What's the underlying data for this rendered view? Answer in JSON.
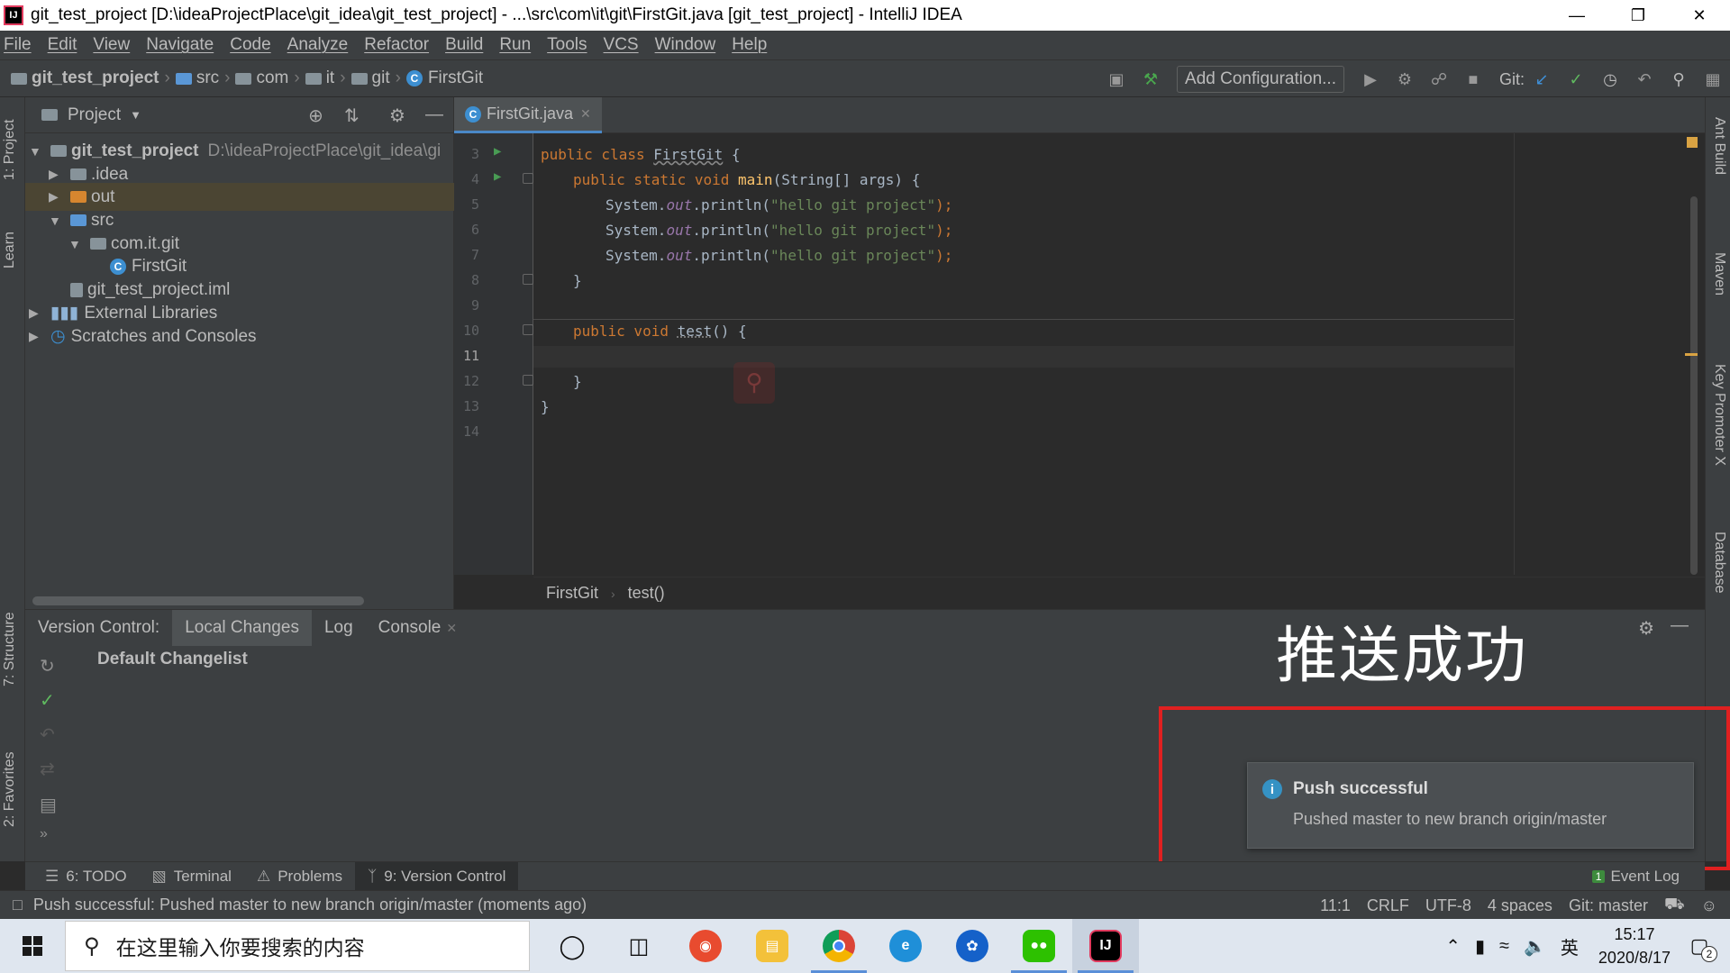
{
  "window": {
    "title": "git_test_project [D:\\ideaProjectPlace\\git_idea\\git_test_project] - ...\\src\\com\\it\\git\\FirstGit.java [git_test_project] - IntelliJ IDEA",
    "app_icon_label": "IJ"
  },
  "menu": [
    "File",
    "Edit",
    "View",
    "Navigate",
    "Code",
    "Analyze",
    "Refactor",
    "Build",
    "Run",
    "Tools",
    "VCS",
    "Window",
    "Help"
  ],
  "navbar": {
    "crumbs": [
      "git_test_project",
      "src",
      "com",
      "it",
      "git",
      "FirstGit"
    ],
    "add_configuration": "Add Configuration...",
    "git_label": "Git:"
  },
  "left_stripe": {
    "project": "1: Project",
    "learn": "Learn",
    "structure": "7: Structure",
    "favorites": "2: Favorites"
  },
  "right_stripe": {
    "ant": "Ant Build",
    "maven": "Maven",
    "key_promoter": "Key Promoter X",
    "database": "Database"
  },
  "project_panel": {
    "title": "Project",
    "tree": [
      {
        "label": "git_test_project",
        "path": "D:\\ideaProjectPlace\\git_idea\\gi"
      },
      {
        "label": ".idea"
      },
      {
        "label": "out"
      },
      {
        "label": "src"
      },
      {
        "label": "com.it.git"
      },
      {
        "label": "FirstGit"
      },
      {
        "label": "git_test_project.iml"
      },
      {
        "label": "External Libraries"
      },
      {
        "label": "Scratches and Consoles"
      }
    ]
  },
  "editor": {
    "tab": "FirstGit.java",
    "line_numbers": [
      "3",
      "4",
      "5",
      "6",
      "7",
      "8",
      "9",
      "10",
      "11",
      "12",
      "13",
      "14"
    ],
    "code": {
      "l3_kw": "public class ",
      "l3_name": "FirstGit",
      "l3_end": " {",
      "l4_kw": "public static void ",
      "l4_fn": "main",
      "l4_end": "(String[] args) {",
      "sys": "System.",
      "out": "out",
      "println": ".println(",
      "str": "\"hello git project\"",
      "close": ");",
      "brace_in": "}",
      "l10_kw": "public void ",
      "l10_fn": "test",
      "l10_end": "() {",
      "brace_out": "}"
    },
    "breadcrumb": [
      "FirstGit",
      "test()"
    ]
  },
  "version_control": {
    "label": "Version Control:",
    "tabs": [
      "Local Changes",
      "Log",
      "Console"
    ],
    "changelist": "Default Changelist"
  },
  "annotation": "推送成功",
  "notification": {
    "title": "Push successful",
    "body": "Pushed master to new branch origin/master"
  },
  "bottom_tools": {
    "todo": "6: TODO",
    "terminal": "Terminal",
    "problems": "Problems",
    "version_control": "9: Version Control",
    "event_log": "Event Log",
    "event_log_count": "1"
  },
  "status_bar": {
    "message": "Push successful: Pushed master to new branch origin/master (moments ago)",
    "position": "11:1",
    "line_sep": "CRLF",
    "encoding": "UTF-8",
    "indent": "4 spaces",
    "branch": "Git: master"
  },
  "taskbar": {
    "search_placeholder": "在这里输入你要搜索的内容",
    "ime": "英",
    "time": "15:17",
    "date": "2020/8/17",
    "notification_count": "2"
  }
}
